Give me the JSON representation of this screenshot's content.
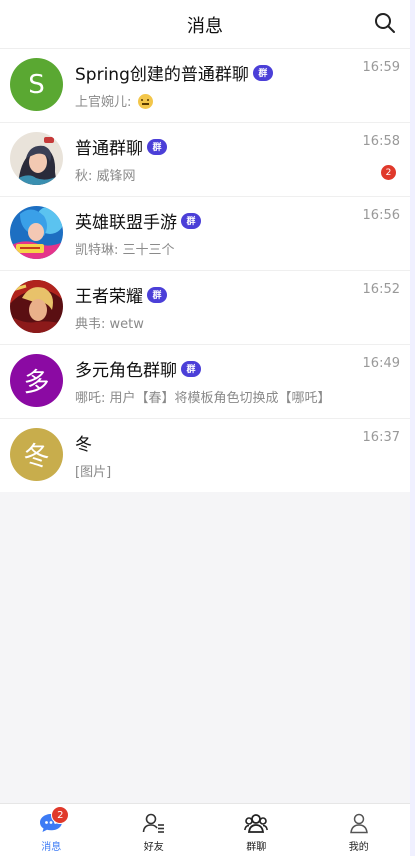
{
  "header": {
    "title": "消息",
    "search_icon": "search-icon"
  },
  "conversations": [
    {
      "name": "Spring创建的普通群聊",
      "group_tag": "群",
      "time": "16:59",
      "preview": "上官婉儿: ",
      "avatar_letter": "S",
      "avatar_color": "#5aa832"
    },
    {
      "name": "普通群聊",
      "group_tag": "群",
      "time": "16:58",
      "preview": "秋: 威锋网",
      "unread": "2"
    },
    {
      "name": "英雄联盟手游",
      "group_tag": "群",
      "time": "16:56",
      "preview": "凯特琳: 三十三个"
    },
    {
      "name": "王者荣耀",
      "group_tag": "群",
      "time": "16:52",
      "preview": "典韦: wetw"
    },
    {
      "name": "多元角色群聊",
      "group_tag": "群",
      "time": "16:49",
      "preview": "哪吒: 用户【春】将模板角色切换成【哪吒】",
      "avatar_letter": "多",
      "avatar_color": "#8b0aa3"
    },
    {
      "name": "冬",
      "time": "16:37",
      "preview": "[图片]",
      "avatar_letter": "冬",
      "avatar_color": "#c8ad4c"
    }
  ],
  "tabbar": {
    "tabs": [
      {
        "label": "消息",
        "badge": "2",
        "active": true
      },
      {
        "label": "好友"
      },
      {
        "label": "群聊"
      },
      {
        "label": "我的"
      }
    ],
    "active_color": "#3d7bf5"
  }
}
